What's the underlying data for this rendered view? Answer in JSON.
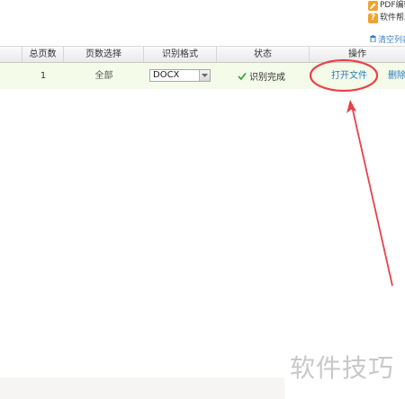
{
  "top_menu": {
    "pdf_edit": {
      "label": "PDF编辑",
      "icon": "edit-icon",
      "color": "#f0a22e"
    },
    "software_help": {
      "label": "软件帮助",
      "icon": "help-icon",
      "color": "#f0a22e"
    }
  },
  "toolbar": {
    "clear_list_label": "清空列表",
    "clear_icon": "trash-icon"
  },
  "table": {
    "columns": [
      "总页数",
      "页数选择",
      "识别格式",
      "状态",
      "操作"
    ],
    "rows": [
      {
        "total_pages": "1",
        "page_selection": "全部",
        "format": "DOCX",
        "status": "识别完成",
        "action_open": "打开文件",
        "action_delete": "删除"
      }
    ]
  },
  "annotation": {
    "color": "#e8424a"
  },
  "watermark": {
    "text": "软件技巧"
  },
  "colors": {
    "row_highlight": "#f4fbe8",
    "link": "#2d7bc4",
    "success_check": "#3aa33a"
  }
}
